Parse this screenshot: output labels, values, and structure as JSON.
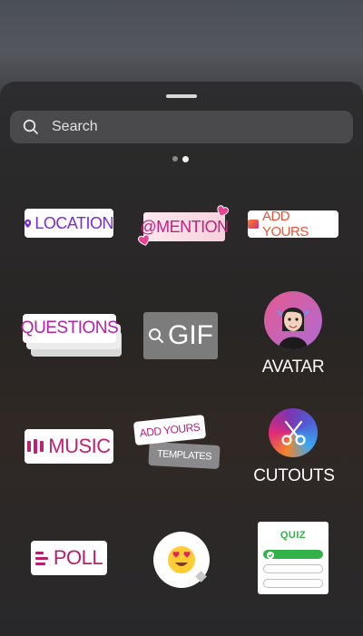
{
  "search": {
    "placeholder": "Search"
  },
  "pager": {
    "active_index": 1,
    "count": 2
  },
  "stickers": {
    "location": "LOCATION",
    "mention": "@MENTION",
    "add_yours": "ADD YOURS",
    "questions": "QUESTIONS",
    "gif": "GIF",
    "avatar": "AVATAR",
    "music": "MUSIC",
    "templates_top": "ADD YOURS",
    "templates_bottom": "TEMPLATES",
    "cutouts": "CUTOUTS",
    "poll": "POLL",
    "emoji": "😍",
    "quiz": "QUIZ"
  },
  "colors": {
    "location": "#7a2bd6",
    "mention": "#c2227d",
    "music": "#c1206f",
    "quiz_green": "#34b24a"
  }
}
